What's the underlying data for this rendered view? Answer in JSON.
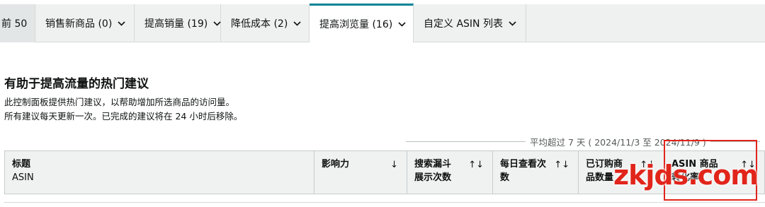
{
  "tabs": [
    {
      "label": "前 50"
    },
    {
      "label": "销售新商品 (0)"
    },
    {
      "label": "提高销量 (19)"
    },
    {
      "label": "降低成本 (2)"
    },
    {
      "label": "提高浏览量 (16)"
    },
    {
      "label": "自定义 ASIN 列表"
    }
  ],
  "active_tab": "提高浏览量 (16)",
  "section": {
    "heading": "有助于提高流量的热门建议",
    "desc1": "此控制面板提供热门建议，以帮助增加所选商品的访问量。",
    "desc2": "所有建议每天更新一次。已完成的建议将在 24 小时后移除。"
  },
  "range_label": "平均超过 7 天 ( 2024/11/3 至 2024/11/9 )",
  "table": {
    "columns": [
      {
        "title": "标题",
        "subtitle": "ASIN",
        "sort": ""
      },
      {
        "title": "影响力",
        "subtitle": "",
        "sort": "↓"
      },
      {
        "title": "搜索漏斗",
        "subtitle": "展示次数",
        "sort": "↑↓"
      },
      {
        "title": "每日查看次",
        "subtitle": "数",
        "sort": "↑↓"
      },
      {
        "title": "已订购商",
        "subtitle": "品数量",
        "sort": "↑↓"
      },
      {
        "title": "ASIN 商品",
        "subtitle": "转化率",
        "sort": "↑↓"
      }
    ]
  },
  "watermark": "zkjds.com",
  "colors": {
    "accent": "#008296",
    "watermark": "#e1251b",
    "header_bg": "#f0f2f2"
  }
}
